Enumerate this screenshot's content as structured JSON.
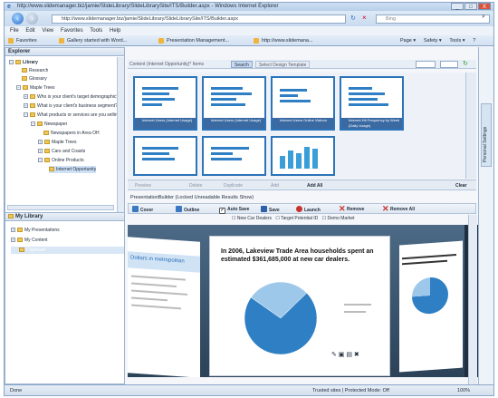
{
  "window": {
    "title": "http://www.slidemanager.biz/jamie/SlideLibrary/SlideLibrarySite/ITS/Builder.aspx - Windows Internet Explorer",
    "url": "http://www.slidemanager.biz/jamie/SlideLibrary/SlideLibrarySite/ITS/Builder.aspx",
    "search_placeholder": "Bing",
    "controls": {
      "minimize": "_",
      "maximize": "□",
      "close": "X"
    }
  },
  "menu": [
    "File",
    "Edit",
    "View",
    "Favorites",
    "Tools",
    "Help"
  ],
  "favorites": {
    "label": "Favorites",
    "items": [
      "Gallery started with Word...",
      "Presentation Management...",
      "http://www.slidemana..."
    ]
  },
  "ie_tools": [
    "Page ▾",
    "Safety ▾",
    "Tools ▾",
    "?"
  ],
  "explorer": {
    "title": "Explorer",
    "root": "Library",
    "items": [
      "Research",
      "Glossary",
      "Maple Trees",
      "Who is your client's target demographic?",
      "What is your client's business segment?",
      "What products or services are you selling?",
      "Newspaper",
      "Newspapers in Area OH",
      "Maple Trees",
      "Cars and Coasts",
      "Online Products",
      "Internet Opportunity"
    ]
  },
  "my_library": {
    "title": "My Library",
    "items": [
      "My Presentations",
      "My Content",
      "Clipboard"
    ]
  },
  "results": {
    "tabs": [
      "Content (Internet Opportunity)* Items",
      "Search",
      "Select Design Template"
    ],
    "thumbnails": [
      "Internet Users (Internet Usage)",
      "Internet Users (Internet Usage)",
      "Internet Users Online Visitors",
      "Internet Hit Frequency by Week (Daily Usage)",
      "",
      "",
      ""
    ],
    "actions": [
      "Preview",
      "Delete",
      "Duplicate",
      "Add",
      "Add All",
      "Clear"
    ]
  },
  "builder": {
    "title": "PresentationBuilder (Locked Unreadable Results Show)",
    "toolbar": [
      "Cover",
      "Outline",
      "Auto Save",
      "Save",
      "Launch",
      "Remove",
      "Remove All"
    ],
    "checkboxes": [
      "New Car Dealers",
      "Target Potential ID",
      "Demo Market"
    ],
    "slide_headline": "In 2006, Lakeview Trade Area households spent an estimated $361,685,000 at new car dealers.",
    "left_slide_heading": "Dollars in metropolitan"
  },
  "pie": {
    "slices": [
      {
        "value": 72,
        "color": "#2f7fc4"
      },
      {
        "value": 28,
        "color": "#9ec8ea"
      }
    ]
  },
  "status": {
    "left": "Done",
    "zone": "Trusted sites | Protected Mode: Off",
    "zoom": "100%"
  },
  "right_tab": "Personal Settings"
}
